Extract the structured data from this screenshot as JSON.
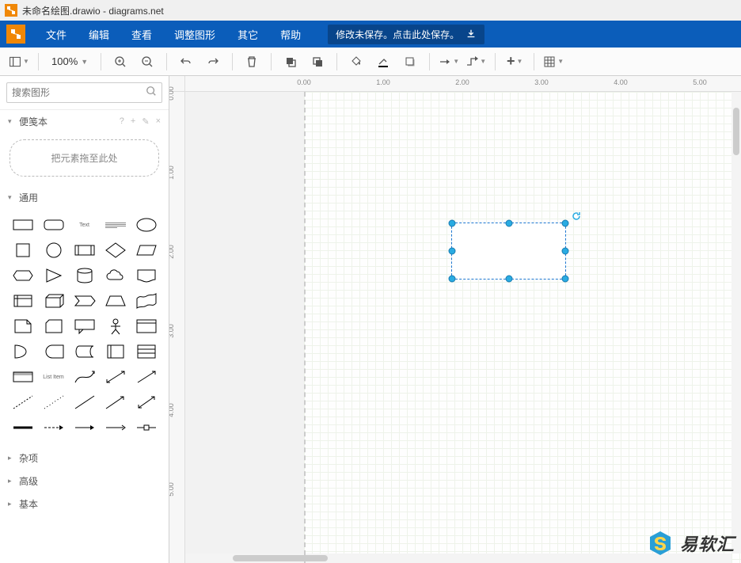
{
  "title": "未命名绘图.drawio - diagrams.net",
  "menu": {
    "file": "文件",
    "edit": "编辑",
    "view": "查看",
    "arrange": "调整图形",
    "extras": "其它",
    "help": "帮助",
    "save_banner": "修改未保存。点击此处保存。"
  },
  "toolbar": {
    "zoom": "100%"
  },
  "sidebar": {
    "search_placeholder": "搜索图形",
    "scratchpad": {
      "label": "便笺本",
      "help": "?",
      "add": "+",
      "edit": "✎",
      "close": "×"
    },
    "dropzone": "把元素拖至此处",
    "general": "通用",
    "misc": "杂项",
    "advanced": "高级",
    "basic": "基本",
    "text_shape": "Text",
    "listitem_shape": "List Item"
  },
  "ruler": {
    "h": [
      "0.00",
      "1.00",
      "2.00",
      "3.00",
      "4.00",
      "5.00"
    ],
    "v": [
      "0.00",
      "1.00",
      "2.00",
      "3.00",
      "4.00",
      "5.00"
    ]
  },
  "watermark": "易软汇",
  "colors": {
    "fill": "#ffffff",
    "line": "#000000",
    "handle": "#29abe2"
  }
}
